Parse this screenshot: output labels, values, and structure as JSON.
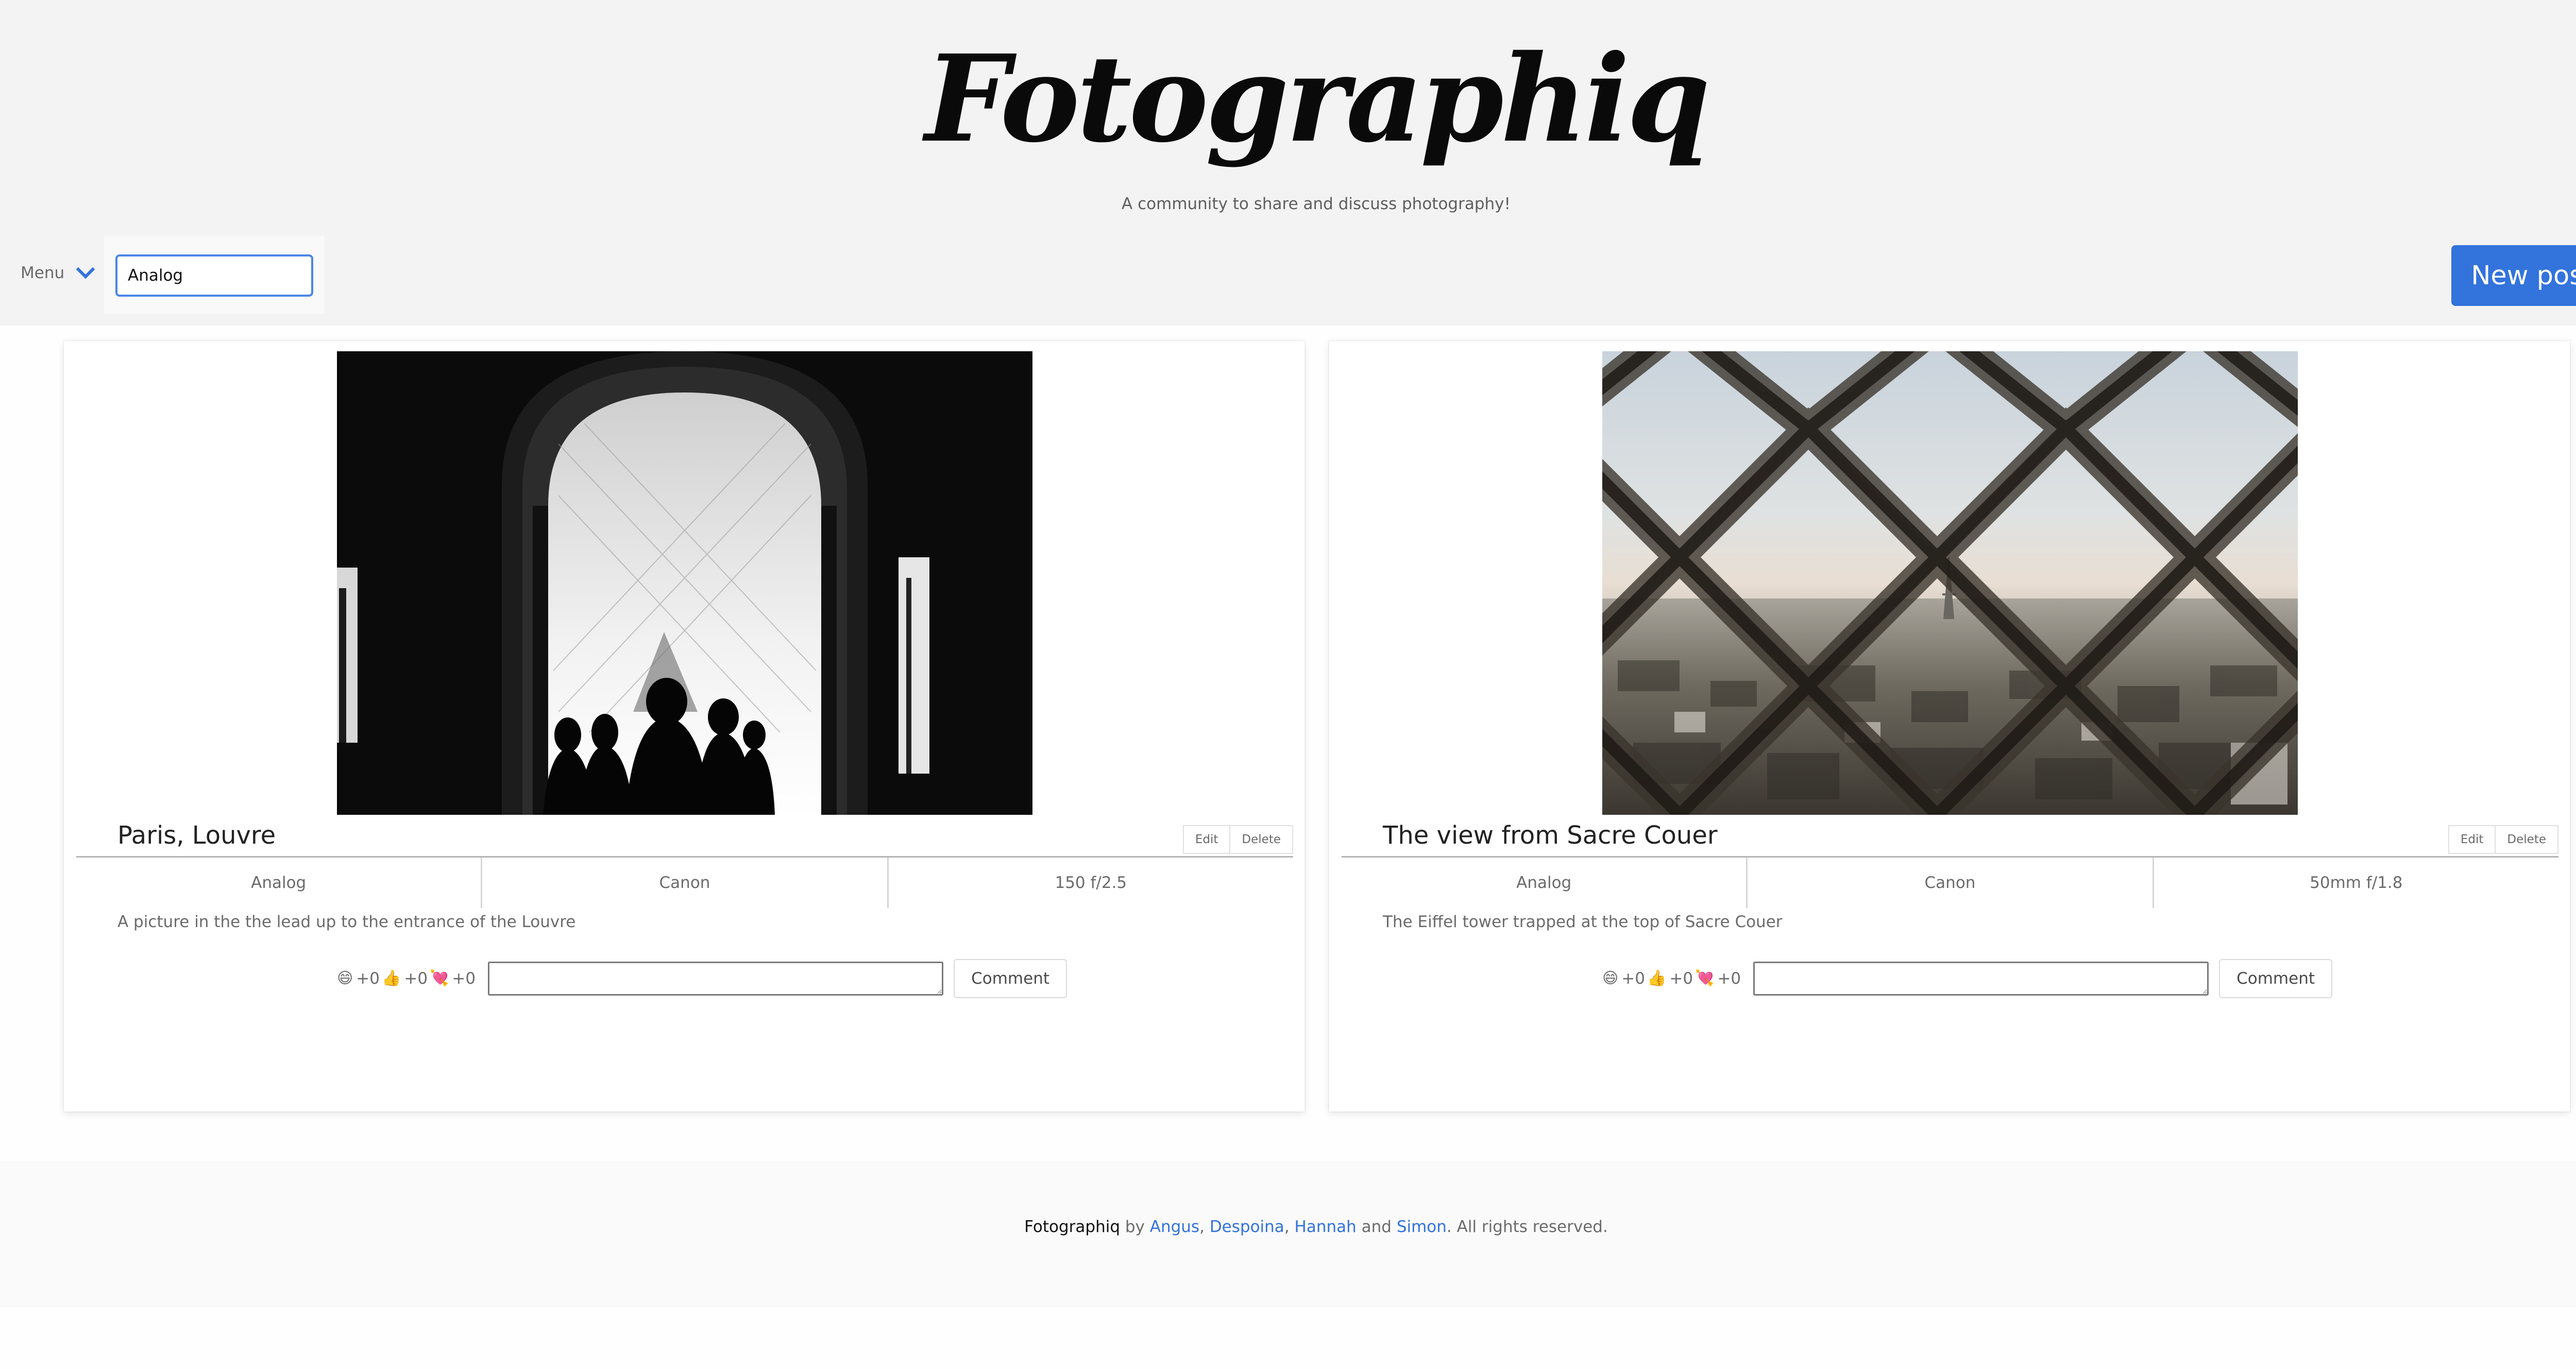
{
  "header": {
    "logo": "Fotographiq",
    "tagline": "A community to share and discuss photography!"
  },
  "nav": {
    "menu_label": "Menu",
    "menu_icon": "chevron-down-icon",
    "search_value": "Analog",
    "new_post_label": "New post"
  },
  "posts": [
    {
      "title": "Paris, Louvre",
      "edit_label": "Edit",
      "delete_label": "Delete",
      "film": "Analog",
      "camera": "Canon",
      "lens": "150 f/2.5",
      "description": "A picture in the the lead up to the entrance of the Louvre",
      "reactions": [
        {
          "emoji": "😄",
          "count": "+0"
        },
        {
          "emoji": "👍",
          "count": "+0"
        },
        {
          "emoji": "💘",
          "count": "+0"
        }
      ],
      "comment_label": "Comment"
    },
    {
      "title": "The view from Sacre Couer",
      "edit_label": "Edit",
      "delete_label": "Delete",
      "film": "Analog",
      "camera": "Canon",
      "lens": "50mm f/1.8",
      "description": "The Eiffel tower trapped at the top of Sacre Couer",
      "reactions": [
        {
          "emoji": "😄",
          "count": "+0"
        },
        {
          "emoji": "👍",
          "count": "+0"
        },
        {
          "emoji": "💘",
          "count": "+0"
        }
      ],
      "comment_label": "Comment"
    }
  ],
  "footer": {
    "brand": "Fotographiq",
    "by": " by ",
    "authors": [
      "Angus",
      "Despoina",
      "Hannah",
      "Simon"
    ],
    "comma": ", ",
    "and": " and ",
    "rights": ". All rights reserved."
  },
  "colors": {
    "accent": "#3273dc",
    "header_bg": "#f3f3f3",
    "footer_bg": "#fafafa"
  }
}
